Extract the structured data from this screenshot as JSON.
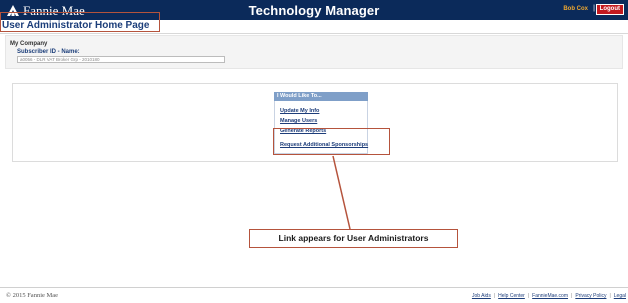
{
  "header": {
    "logo_text": "Fannie Mae",
    "app_title": "Technology Manager",
    "user_name": "Bob Cox",
    "separator": "|",
    "logout_label": "Logout"
  },
  "page": {
    "title": "User Administrator Home Page"
  },
  "company": {
    "label": "My Company",
    "subscriber_label": "Subscriber ID - Name:",
    "subscriber_value": "a0056 - DLR VAT Broker Grp - 2010180"
  },
  "menu": {
    "header": "I Would Like To...",
    "links": [
      "Update My Info",
      "Manage Users",
      "Generate Reports",
      "Request Additional Sponsorships"
    ]
  },
  "annotation": {
    "callout_text": "Link appears for User Administrators",
    "accent_color": "#b5533c"
  },
  "footer": {
    "copyright": "© 2015 Fannie Mae",
    "links": [
      "Job Aids",
      "Help Center",
      "FannieMae.com",
      "Privacy Policy",
      "Legal"
    ]
  },
  "colors": {
    "header_bg": "#0b2a5a",
    "title_color": "#1c3e7a",
    "logout_bg": "#c2191f",
    "menu_header_bg": "#7f9fc8"
  }
}
